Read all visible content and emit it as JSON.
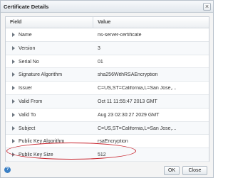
{
  "dialog": {
    "title": "Certificate Details",
    "close_glyph": "×"
  },
  "table": {
    "headers": {
      "field": "Field",
      "value": "Value"
    },
    "rows": [
      {
        "field": "Name",
        "value": "ns-server-certificate"
      },
      {
        "field": "Version",
        "value": "3"
      },
      {
        "field": "Serial No",
        "value": "01"
      },
      {
        "field": "Signature Algorithm",
        "value": "sha256WithRSAEncryption"
      },
      {
        "field": "Issuer",
        "value": "C=US,ST=California,L=San Jose,..."
      },
      {
        "field": "Valid From",
        "value": "Oct 11 11:55:47 2013 GMT"
      },
      {
        "field": "Valid To",
        "value": "Aug 23 02:30:27 2029 GMT"
      },
      {
        "field": "Subject",
        "value": "C=US,ST=California,L=San Jose,..."
      },
      {
        "field": "Public Key Algorithm",
        "value": "rsaEncryption"
      },
      {
        "field": "Public Key Size",
        "value": "512"
      }
    ]
  },
  "footer": {
    "help_glyph": "?",
    "ok_label": "OK",
    "close_label": "Close"
  },
  "colors": {
    "highlight": "#c8232c",
    "help": "#3a7fc4"
  }
}
